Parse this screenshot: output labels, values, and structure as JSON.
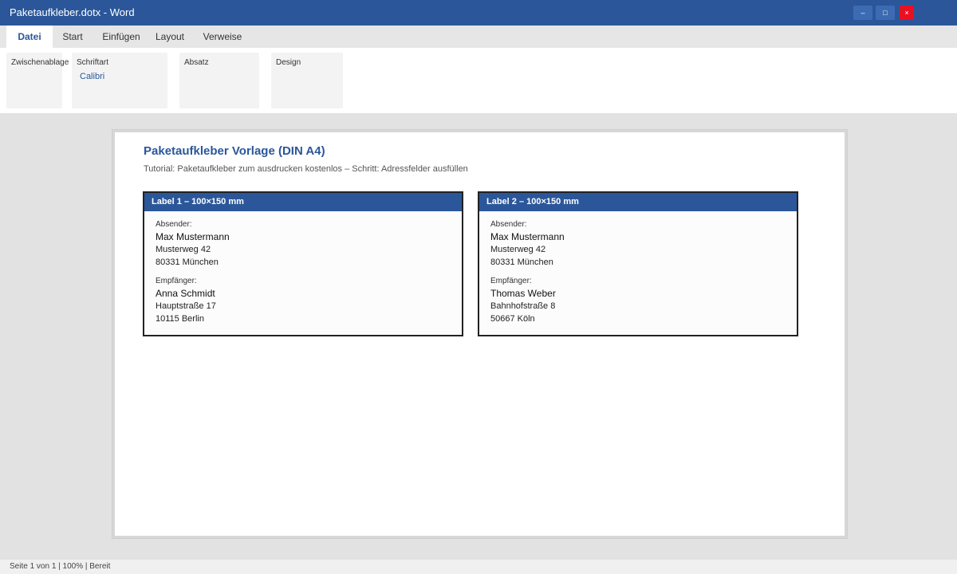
{
  "window": {
    "title": "Paketaufkleber.dotx - Word",
    "buttons": {
      "minimize": "–",
      "maximize": "□",
      "close": "×"
    },
    "accent_color": "#2b579a"
  },
  "menu": {
    "tabs": [
      "Datei",
      "Start",
      "Einfügen",
      "Layout",
      "Verweise"
    ],
    "active_tab": "Datei"
  },
  "ribbon": {
    "groups": [
      "Zwischenablage",
      "Schriftart",
      "Absatz",
      "Design"
    ],
    "font_value": "Calibri"
  },
  "document": {
    "title": "Paketaufkleber Vorlage (DIN A4)",
    "subtitle": "Tutorial: Paketaufkleber zum ausdrucken kostenlos – Schritt: Adressfelder ausfüllen",
    "labels": [
      {
        "header": "Label 1 – 100×150 mm",
        "sender_label": "Absender:",
        "sender": {
          "name": "Max Mustermann",
          "street": "Musterweg 42",
          "city": "80331 München"
        },
        "recipient_label": "Empfänger:",
        "recipient": {
          "name": "Anna Schmidt",
          "street": "Hauptstraße 17",
          "city": "10115 Berlin"
        }
      },
      {
        "header": "Label 2 – 100×150 mm",
        "sender_label": "Absender:",
        "sender": {
          "name": "Max Mustermann",
          "street": "Musterweg 42",
          "city": "80331 München"
        },
        "recipient_label": "Empfänger:",
        "recipient": {
          "name": "Thomas Weber",
          "street": "Bahnhofstraße 8",
          "city": "50667 Köln"
        }
      }
    ]
  },
  "status": {
    "text": "Seite 1 von 1 | 100% | Bereit"
  }
}
